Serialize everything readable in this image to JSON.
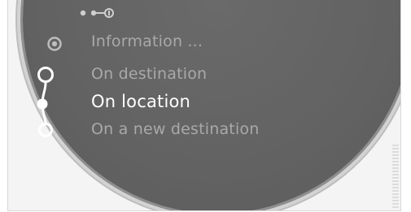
{
  "menu": {
    "items": [
      {
        "label": "Information ...",
        "icon": "radio-target-icon"
      },
      {
        "label": "On destination",
        "icon": "route-start-icon"
      },
      {
        "label": "On location",
        "icon": "route-current-icon",
        "selected": true
      },
      {
        "label": "On a new destination",
        "icon": "route-end-icon"
      }
    ]
  },
  "colors": {
    "panel": "#626262",
    "text_dim": "#a9a9a9",
    "text_selected": "#ffffff"
  }
}
